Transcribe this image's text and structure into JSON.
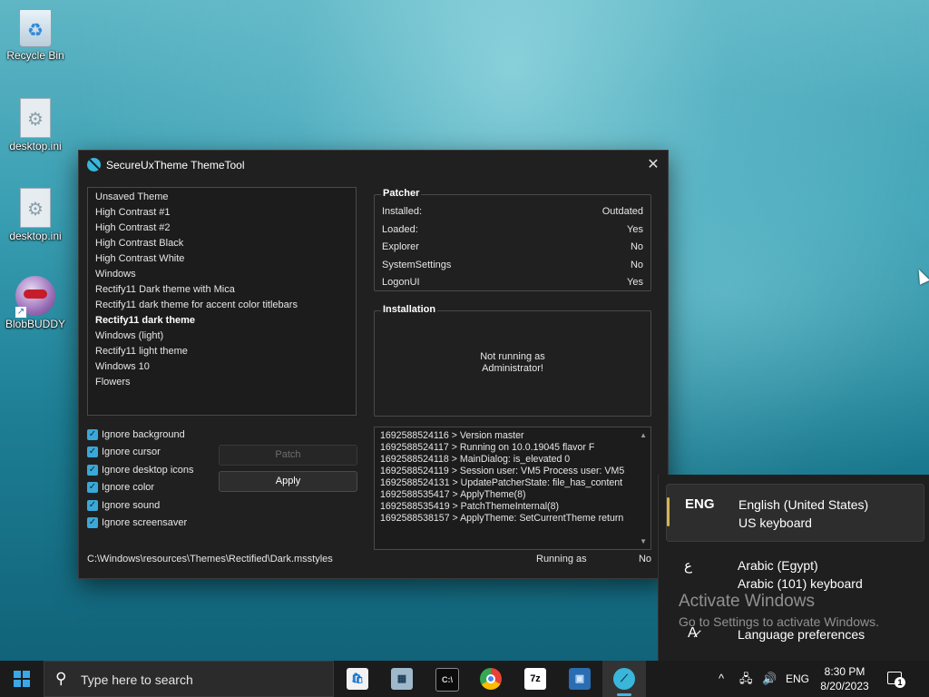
{
  "desktop": {
    "icons": [
      {
        "label": "Recycle Bin"
      },
      {
        "label": "desktop.ini"
      },
      {
        "label": "desktop.ini"
      },
      {
        "label": "BlobBUDDY"
      }
    ]
  },
  "window": {
    "title": "SecureUxTheme ThemeTool",
    "close_glyph": "✕",
    "themes": [
      "Unsaved Theme",
      "High Contrast #1",
      "High Contrast #2",
      "High Contrast Black",
      "High Contrast White",
      "Windows",
      "Rectify11 Dark theme with Mica",
      "Rectify11 dark theme for accent color titlebars",
      "Rectify11 dark theme",
      "Windows (light)",
      "Rectify11 light theme",
      "Windows 10",
      "Flowers"
    ],
    "selected_theme": "Rectify11 dark theme",
    "options": [
      {
        "label": "Ignore background",
        "checked": true
      },
      {
        "label": "Ignore cursor",
        "checked": true
      },
      {
        "label": "Ignore desktop icons",
        "checked": true
      },
      {
        "label": "Ignore color",
        "checked": true
      },
      {
        "label": "Ignore sound",
        "checked": true
      },
      {
        "label": "Ignore screensaver",
        "checked": true
      }
    ],
    "patch_label": "Patch",
    "apply_label": "Apply",
    "patcher": {
      "title": "Patcher",
      "rows": [
        {
          "key": "Installed:",
          "value": "Outdated"
        },
        {
          "key": "Loaded:",
          "value": "Yes"
        },
        {
          "key": "Explorer",
          "value": "No"
        },
        {
          "key": "SystemSettings",
          "value": "No"
        },
        {
          "key": "LogonUI",
          "value": "Yes"
        }
      ]
    },
    "installation": {
      "title": "Installation",
      "message_line1": "Not running as",
      "message_line2": "Administrator!"
    },
    "log": [
      "1692588524116 > Version master",
      "1692588524117 > Running on 10.0.19045 flavor F",
      "1692588524118 > MainDialog: is_elevated 0",
      "1692588524119 > Session user: VM5 Process user: VM5",
      "1692588524131 > UpdatePatcherState: file_has_content",
      "1692588535417 > ApplyTheme(8)",
      "1692588535419 > PatchThemeInternal(8)",
      "1692588538157 > ApplyTheme: SetCurrentTheme return"
    ],
    "status": {
      "path": "C:\\Windows\\resources\\Themes\\Rectified\\Dark.msstyles",
      "running_label": "Running as",
      "running_value": "No"
    }
  },
  "language_flyout": {
    "items": [
      {
        "code": "ENG",
        "name": "English (United States)",
        "keyboard": "US keyboard",
        "active": true
      },
      {
        "code": "ع",
        "name": "Arabic (Egypt)",
        "keyboard": "Arabic (101) keyboard",
        "active": false
      }
    ],
    "preferences_label": "Language preferences"
  },
  "watermark": {
    "title": "Activate Windows",
    "subtitle": "Go to Settings to activate Windows."
  },
  "taskbar": {
    "search_placeholder": "Type here to search",
    "apps": [
      {
        "name": "microsoft-store-icon",
        "glyph": "🛍"
      },
      {
        "name": "control-panel-icon",
        "glyph": "▦"
      },
      {
        "name": "command-prompt-icon",
        "glyph": "C:\\"
      },
      {
        "name": "chrome-icon",
        "glyph": "●"
      },
      {
        "name": "7zip-icon",
        "glyph": "7z"
      },
      {
        "name": "remote-desktop-icon",
        "glyph": "▣"
      },
      {
        "name": "securеuxtheme-icon",
        "glyph": "⟋"
      }
    ],
    "tray": {
      "chevron": "^",
      "network": "🖧",
      "volume": "🔊",
      "language": "ENG"
    },
    "time": "8:30 PM",
    "date": "8/20/2023",
    "notifications_count": "1"
  }
}
